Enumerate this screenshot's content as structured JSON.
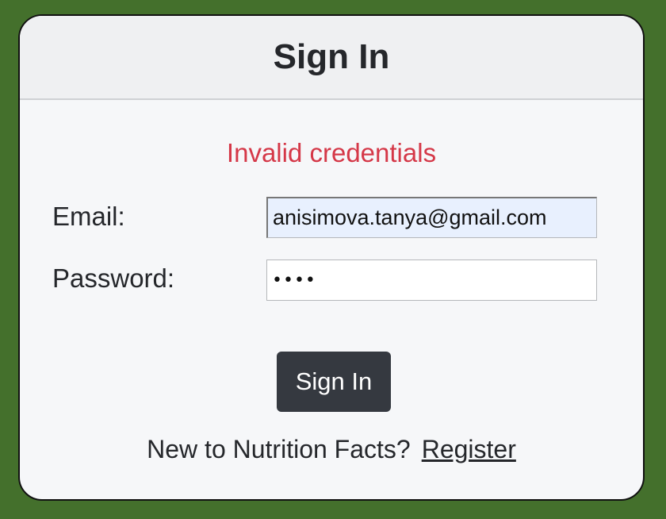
{
  "form": {
    "title": "Sign In",
    "error_message": "Invalid credentials",
    "email_label": "Email:",
    "email_value": "anisimova.tanya@gmail.com",
    "password_label": "Password:",
    "password_value": "abcd",
    "submit_label": "Sign In",
    "footer_text": "New to Nutrition Facts?",
    "register_link": "Register"
  },
  "colors": {
    "page_background": "#44702c",
    "error": "#d53848",
    "button": "#353940",
    "autofill": "#e8f0fe"
  }
}
